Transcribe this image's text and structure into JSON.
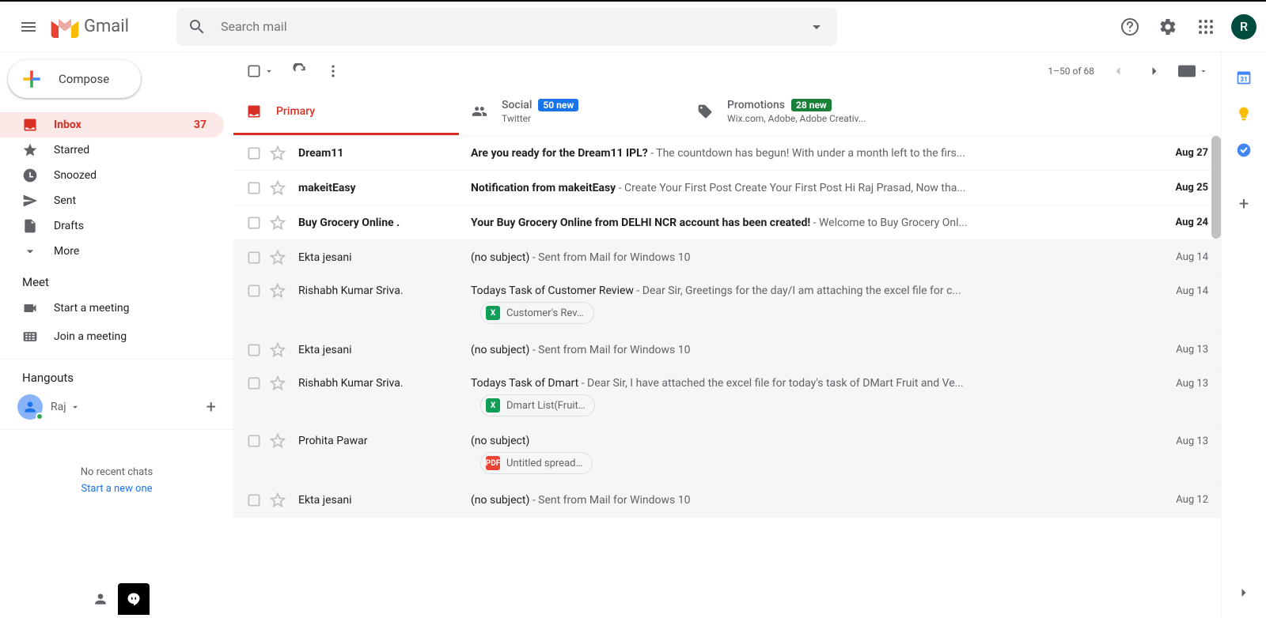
{
  "header": {
    "product": "Gmail",
    "search_placeholder": "Search mail",
    "avatar_initial": "R"
  },
  "compose": {
    "label": "Compose"
  },
  "nav": {
    "inbox": {
      "label": "Inbox",
      "count": "37"
    },
    "starred": {
      "label": "Starred"
    },
    "snoozed": {
      "label": "Snoozed"
    },
    "sent": {
      "label": "Sent"
    },
    "drafts": {
      "label": "Drafts"
    },
    "more": {
      "label": "More"
    }
  },
  "meet": {
    "title": "Meet",
    "start": "Start a meeting",
    "join": "Join a meeting"
  },
  "hangouts": {
    "title": "Hangouts",
    "user": "Raj",
    "no_recent": "No recent chats",
    "start_new": "Start a new one"
  },
  "toolbar": {
    "range": "1–50 of 68"
  },
  "tabs": {
    "primary": {
      "label": "Primary"
    },
    "social": {
      "label": "Social",
      "badge": "50 new",
      "sub": "Twitter"
    },
    "promotions": {
      "label": "Promotions",
      "badge": "28 new",
      "sub": "Wix.com, Adobe, Adobe Creativ..."
    }
  },
  "mails": [
    {
      "sender": "Dream11",
      "subject": "Are you ready for the Dream11 IPL?",
      "snippet": " - The countdown has begun! With under a month left to the firs...",
      "date": "Aug 27",
      "unread": true
    },
    {
      "sender": "makeitEasy",
      "subject": "Notification from makeitEasy",
      "snippet": " - Create Your First Post Create Your First Post Hi Raj Prasad, Now tha...",
      "date": "Aug 25",
      "unread": true
    },
    {
      "sender": "Buy Grocery Online .",
      "subject": "Your Buy Grocery Online from DELHI NCR account has been created!",
      "snippet": " - Welcome to Buy Grocery Onl...",
      "date": "Aug 24",
      "unread": true
    },
    {
      "sender": "Ekta jesani",
      "subject": "(no subject)",
      "snippet": " - Sent from Mail for Windows 10",
      "date": "Aug 14",
      "unread": false
    },
    {
      "sender": "Rishabh Kumar Sriva.",
      "subject": "Todays Task of Customer Review",
      "snippet": " - Dear Sir, Greetings for the day/I am attaching the excel file for c...",
      "date": "Aug 14",
      "unread": false,
      "attachment": {
        "type": "x",
        "label": "Customer's Rev…"
      }
    },
    {
      "sender": "Ekta jesani",
      "subject": "(no subject)",
      "snippet": " - Sent from Mail for Windows 10",
      "date": "Aug 13",
      "unread": false
    },
    {
      "sender": "Rishabh Kumar Sriva.",
      "subject": "Todays Task of Dmart",
      "snippet": " - Dear Sir, I have attached the excel file for today's task of DMart Fruit and Ve...",
      "date": "Aug 13",
      "unread": false,
      "attachment": {
        "type": "x",
        "label": "Dmart List(Fruit…"
      }
    },
    {
      "sender": "Prohita Pawar",
      "subject": "(no subject)",
      "snippet": "",
      "date": "Aug 13",
      "unread": false,
      "attachment": {
        "type": "pdf",
        "label": "Untitled spread…"
      }
    },
    {
      "sender": "Ekta jesani",
      "subject": "(no subject)",
      "snippet": " - Sent from Mail for Windows 10",
      "date": "Aug 12",
      "unread": false
    }
  ]
}
